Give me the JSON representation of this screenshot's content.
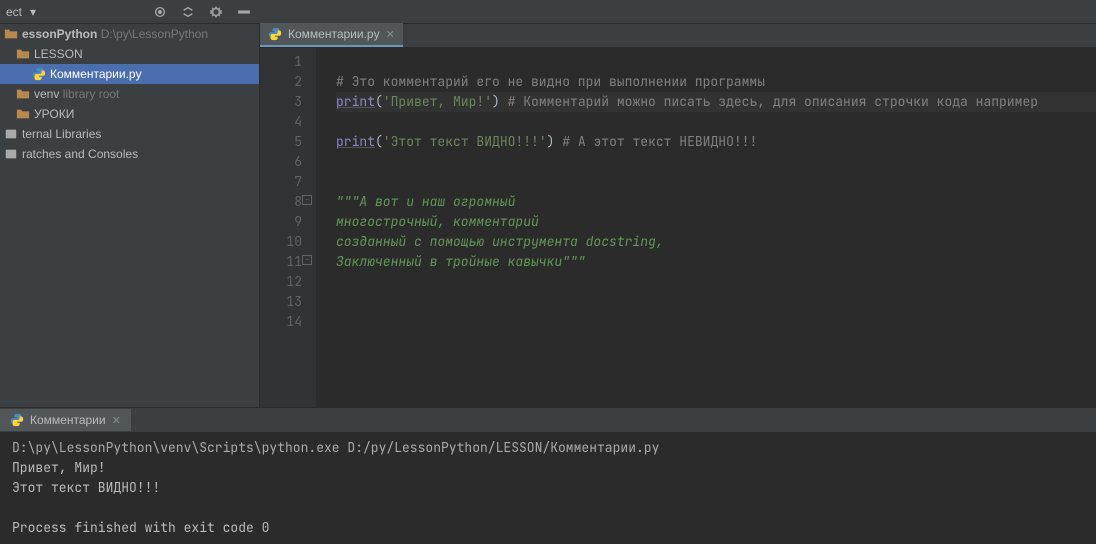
{
  "toolbar": {
    "project_label": "ect",
    "arrow_glyph": "▾"
  },
  "project_tree": {
    "root": {
      "name": "essonPython",
      "path": "D:\\py\\LessonPython"
    },
    "items": [
      {
        "name": "LESSON",
        "indent": 1,
        "type": "folder"
      },
      {
        "name": "Комментарии.py",
        "indent": 2,
        "type": "python",
        "selected": true
      },
      {
        "name": "venv",
        "suffix": "library root",
        "indent": 1,
        "type": "folder"
      },
      {
        "name": "УРОКИ",
        "indent": 1,
        "type": "folder"
      },
      {
        "name": "ternal Libraries",
        "indent": 0,
        "type": "lib"
      },
      {
        "name": "ratches and Consoles",
        "indent": 0,
        "type": "lib"
      }
    ]
  },
  "editor": {
    "tab_label": "Комментарии.py",
    "lines": [
      {
        "n": 1,
        "html": ""
      },
      {
        "n": 2,
        "html": "<span class='c-comment'># Это комментарий его не видно при выполнении программы</span>"
      },
      {
        "n": 3,
        "html": "<span class='c-builtin c-hl'>print</span><span class='c-paren'>(</span><span class='c-string'>'Привет, Мир!'</span><span class='c-paren'>)</span> <span class='c-comment'># Комментарий можно писать здесь, для описания строчки кода например</span>",
        "current": true
      },
      {
        "n": 4,
        "html": ""
      },
      {
        "n": 5,
        "html": "<span class='c-builtin c-hl'>print</span><span class='c-paren'>(</span><span class='c-string'>'Этот текст ВИДНО!!!'</span><span class='c-paren'>)</span> <span class='c-comment'># А этот текст НЕВИДНО!!!</span>"
      },
      {
        "n": 6,
        "html": ""
      },
      {
        "n": 7,
        "html": ""
      },
      {
        "n": 8,
        "html": "<span class='c-docstring'>\"\"\"А вот и наш огромный</span>",
        "fold": "start"
      },
      {
        "n": 9,
        "html": "<span class='c-docstring'>многострочный, комментарий</span>"
      },
      {
        "n": 10,
        "html": "<span class='c-docstring'>созданный с помощью инструмента docstring,</span>"
      },
      {
        "n": 11,
        "html": "<span class='c-docstring'>Заключенный в тройные кавычки\"\"\"</span>",
        "fold": "end"
      },
      {
        "n": 12,
        "html": ""
      },
      {
        "n": 13,
        "html": ""
      },
      {
        "n": 14,
        "html": ""
      }
    ]
  },
  "run": {
    "tab_label": "Комментарии",
    "command": "D:\\py\\LessonPython\\venv\\Scripts\\python.exe D:/py/LessonPython/LESSON/Комментарии.py",
    "out1": "Привет, Мир!",
    "out2": "Этот текст ВИДНО!!!",
    "exit": "Process finished with exit code 0"
  }
}
